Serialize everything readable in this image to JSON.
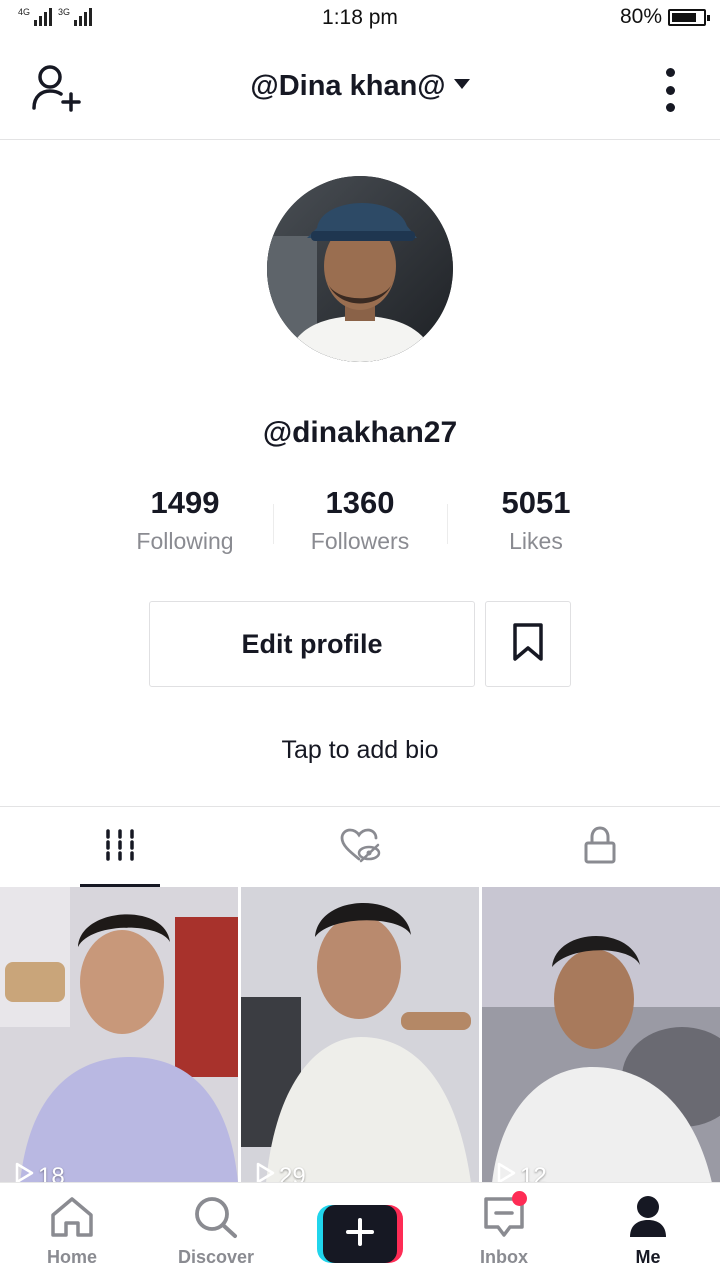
{
  "status_bar": {
    "signal_1": "4G",
    "signal_2": "3G",
    "time": "1:18 pm",
    "battery": "80%"
  },
  "header": {
    "title": "@Dina khan@"
  },
  "profile": {
    "username": "@dinakhan27",
    "stats": [
      {
        "value": "1499",
        "label": "Following"
      },
      {
        "value": "1360",
        "label": "Followers"
      },
      {
        "value": "5051",
        "label": "Likes"
      }
    ],
    "edit_label": "Edit profile",
    "bio_placeholder": "Tap to add bio"
  },
  "tabs": [
    "videos-grid-icon",
    "liked-hidden-icon",
    "private-lock-icon"
  ],
  "videos": [
    {
      "views": "18"
    },
    {
      "views": "29"
    },
    {
      "views": "12"
    }
  ],
  "bottom_nav": {
    "home": "Home",
    "discover": "Discover",
    "inbox": "Inbox",
    "me": "Me"
  },
  "colors": {
    "accent_pink": "#fe2c55",
    "accent_cyan": "#20d5ec",
    "text_primary": "#161823",
    "text_secondary": "#8a8b91"
  }
}
